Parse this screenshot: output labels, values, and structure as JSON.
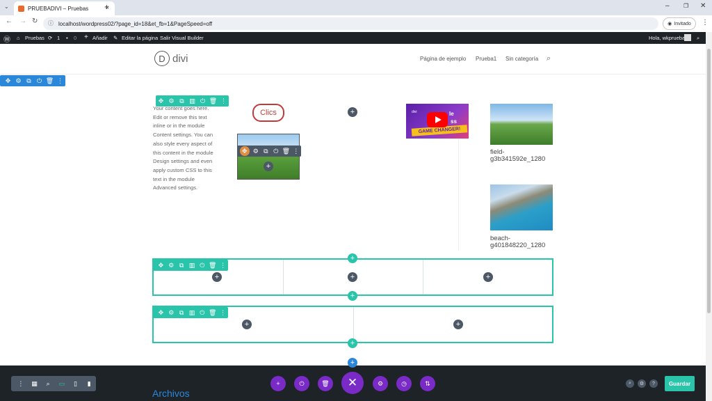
{
  "browser": {
    "tab_title": "PRUEBADIVI – Pruebas",
    "url": "localhost/wordpress02/?page_id=18&et_fb=1&PageSpeed=off",
    "guest_label": "Invitado",
    "new_tab": "+",
    "close_tab": "×"
  },
  "adminbar": {
    "site": "Pruebas",
    "updates": "1",
    "comments": "0",
    "add": "Añadir",
    "edit": "Editar la página",
    "exit": "Salir Visual Builder",
    "greeting": "Hola, wkprueba"
  },
  "site": {
    "logo_letter": "D",
    "logo_text": "divi",
    "menu": [
      "Página de ejemplo",
      "Prueba1",
      "Sin categoría"
    ]
  },
  "content": {
    "text_module": "Your content goes here. Edit or remove this text inline or in the module Content settings. You can also style every aspect of this content in the module Design settings and even apply custom CSS to this text in the module Advanced settings.",
    "button_label": "Clics",
    "video_banner": "GAME CHANGER!",
    "video_title_fragment": "le",
    "video_title_fragment2": "ss",
    "video_logo": "divi",
    "image1_caption": "field-g3b341592e_1280",
    "image2_caption": "beach-g401848220_1280",
    "archives_heading": "Archivos"
  },
  "builder": {
    "save_label": "Guardar"
  },
  "colors": {
    "section_blue": "#2b87da",
    "row_green": "#29c4a9",
    "module_gray": "#4c5866",
    "purple": "#7a2bc7",
    "button_red": "#c03a3a"
  }
}
